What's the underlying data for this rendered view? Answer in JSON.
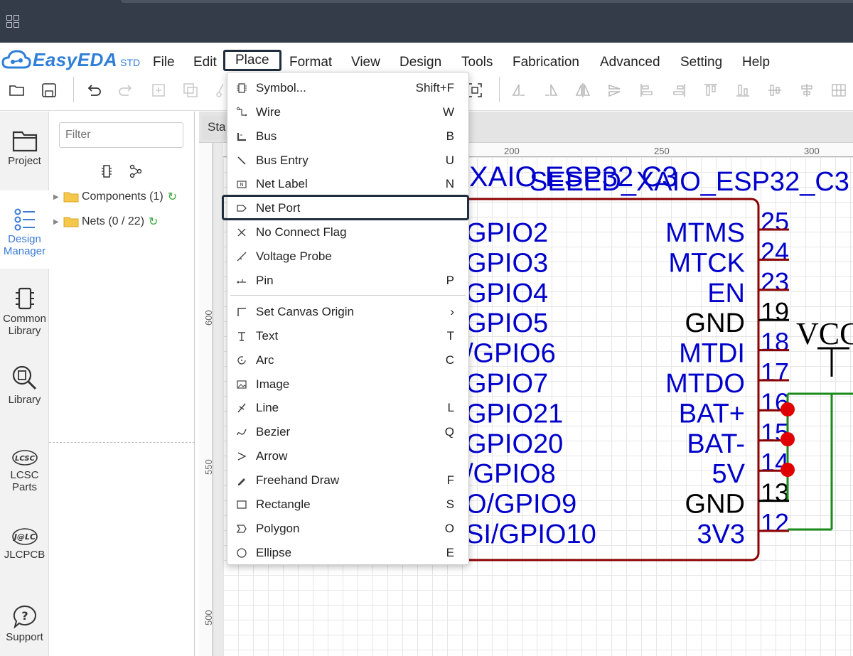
{
  "app": {
    "name": "EasyEDA",
    "edition": "STD"
  },
  "menu": [
    "File",
    "Edit",
    "Place",
    "Format",
    "View",
    "Design",
    "Tools",
    "Fabrication",
    "Advanced",
    "Setting",
    "Help"
  ],
  "active_menu": "Place",
  "rail": [
    {
      "label": "Project",
      "icon": "folder-icon"
    },
    {
      "label": "Design Manager",
      "icon": "design-manager-icon",
      "active": true
    },
    {
      "label": "Common Library",
      "icon": "chip-icon"
    },
    {
      "label": "Library",
      "icon": "library-search-icon"
    },
    {
      "label": "LCSC Parts",
      "icon": "lcsc-icon"
    },
    {
      "label": "JLCPCB",
      "icon": "jlc-icon"
    },
    {
      "label": "Support",
      "icon": "help-icon"
    }
  ],
  "panel": {
    "filter_placeholder": "Filter",
    "tree": [
      {
        "label": "Components (1)"
      },
      {
        "label": "Nets (0 / 22)"
      }
    ]
  },
  "doc_tab": "Sta",
  "ruler": {
    "top": [
      "200",
      "250",
      "300"
    ],
    "left": [
      "600",
      "550",
      "500"
    ]
  },
  "place_menu": {
    "items": [
      {
        "label": "Symbol...",
        "shortcut": "Shift+F",
        "icon": "symbol-icon"
      },
      {
        "label": "Wire",
        "shortcut": "W",
        "icon": "wire-icon"
      },
      {
        "label": "Bus",
        "shortcut": "B",
        "icon": "bus-icon"
      },
      {
        "label": "Bus Entry",
        "shortcut": "U",
        "icon": "bus-entry-icon"
      },
      {
        "label": "Net Label",
        "shortcut": "N",
        "icon": "net-label-icon"
      },
      {
        "label": "Net Port",
        "shortcut": "",
        "icon": "net-port-icon",
        "highlight": true
      },
      {
        "label": "No Connect Flag",
        "shortcut": "",
        "icon": "no-connect-icon"
      },
      {
        "label": "Voltage Probe",
        "shortcut": "",
        "icon": "voltage-probe-icon"
      },
      {
        "label": "Pin",
        "shortcut": "P",
        "icon": "pin-icon"
      },
      {
        "label": "Set Canvas Origin",
        "shortcut": "›",
        "icon": "canvas-origin-icon"
      },
      {
        "label": "Text",
        "shortcut": "T",
        "icon": "text-icon"
      },
      {
        "label": "Arc",
        "shortcut": "C",
        "icon": "arc-icon"
      },
      {
        "label": "Image",
        "shortcut": "",
        "icon": "image-icon"
      },
      {
        "label": "Line",
        "shortcut": "L",
        "icon": "line-icon"
      },
      {
        "label": "Bezier",
        "shortcut": "Q",
        "icon": "bezier-icon"
      },
      {
        "label": "Arrow",
        "shortcut": "",
        "icon": "arrow-icon"
      },
      {
        "label": "Freehand Draw",
        "shortcut": "F",
        "icon": "freehand-icon"
      },
      {
        "label": "Rectangle",
        "shortcut": "S",
        "icon": "rectangle-icon"
      },
      {
        "label": "Polygon",
        "shortcut": "O",
        "icon": "polygon-icon"
      },
      {
        "label": "Ellipse",
        "shortcut": "E",
        "icon": "ellipse-icon"
      }
    ]
  },
  "schematic": {
    "title_a": "XAIO ESP32 C3",
    "title_b": "SEEED_XAIO_ESP32_C3",
    "left_pins": [
      "GPIO2",
      "GPIO3",
      "GPIO4",
      "GPIO5",
      "/GPIO6",
      "GPIO7",
      "GPIO21",
      "GPIO20",
      "/GPIO8",
      "O/GPIO9",
      "SI/GPIO10"
    ],
    "right_pins": [
      {
        "name": "MTMS",
        "num": "25"
      },
      {
        "name": "MTCK",
        "num": "24"
      },
      {
        "name": "EN",
        "num": "23"
      },
      {
        "name": "GND",
        "num": "19"
      },
      {
        "name": "MTDI",
        "num": "18"
      },
      {
        "name": "MTDO",
        "num": "17"
      },
      {
        "name": "BAT+",
        "num": "16"
      },
      {
        "name": "BAT-",
        "num": "15"
      },
      {
        "name": "5V",
        "num": "14"
      },
      {
        "name": "GND",
        "num": "13"
      },
      {
        "name": "3V3",
        "num": "12"
      }
    ],
    "power_label": "VCC",
    "colors": {
      "pin_text": "#0000cc",
      "body": "#8b0000",
      "wire": "#1a8a1a",
      "junction": "#e00000",
      "grid_line": "#e6e6e6"
    }
  }
}
